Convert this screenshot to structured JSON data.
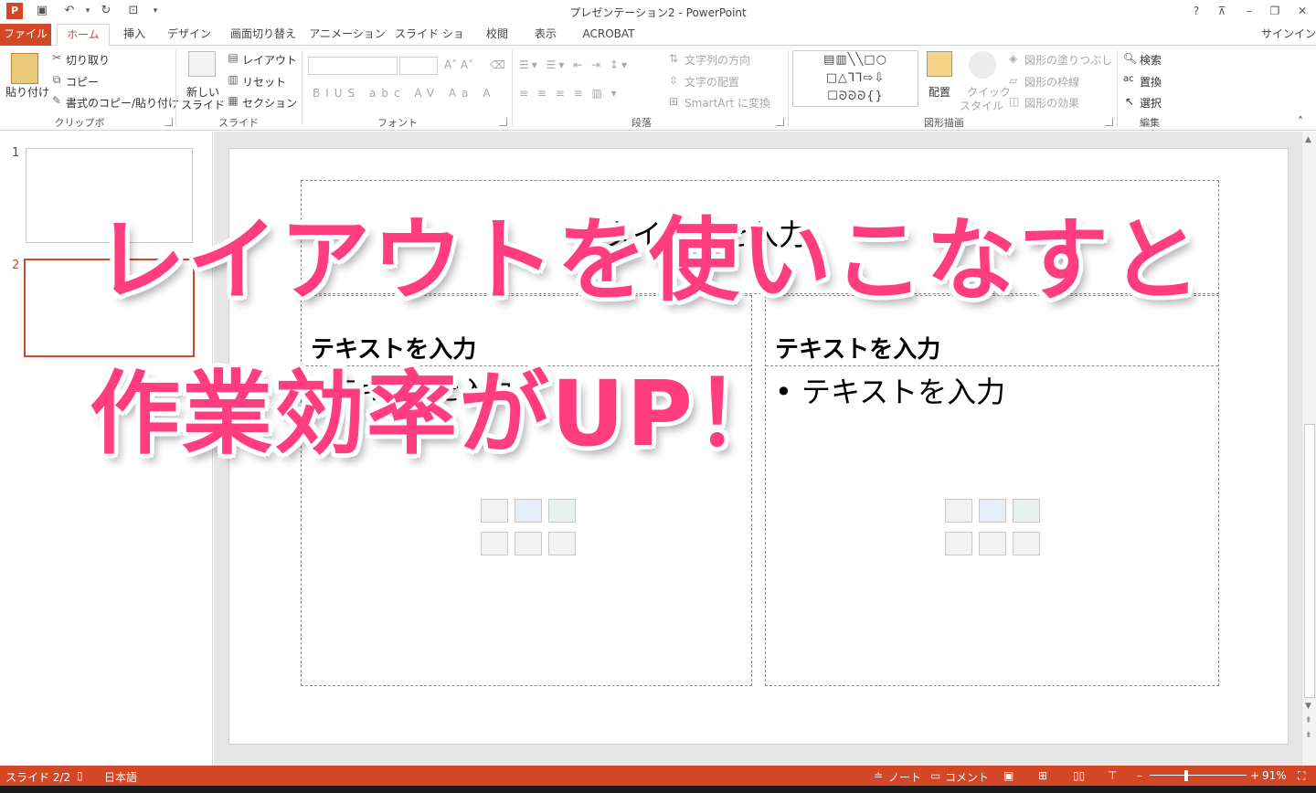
{
  "window": {
    "title": "プレゼンテーション2 - PowerPoint",
    "help": "?",
    "signin": "サインイン"
  },
  "tabs": [
    "ファイル",
    "ホーム",
    "挿入",
    "デザイン",
    "画面切り替え",
    "アニメーション",
    "スライド ショー",
    "校閲",
    "表示",
    "ACROBAT"
  ],
  "ribbon": {
    "clipboard": {
      "label": "クリップボード",
      "paste": "貼り付け",
      "cut": "切り取り",
      "copy": "コピー",
      "format_painter": "書式のコピー/貼り付け"
    },
    "slides": {
      "label": "スライド",
      "new_slide_1": "新しい",
      "new_slide_2": "スライド",
      "layout": "レイアウト",
      "reset": "リセット",
      "section": "セクション"
    },
    "font": {
      "label": "フォント"
    },
    "paragraph": {
      "label": "段落",
      "text_direction": "文字列の方向",
      "align_text": "文字の配置",
      "smartart": "SmartArt に変換"
    },
    "drawing": {
      "label": "図形描画",
      "arrange": "配置",
      "quick_styles_1": "クイック",
      "quick_styles_2": "スタイル",
      "shape_fill": "図形の塗りつぶし",
      "shape_outline": "図形の枠線",
      "shape_effects": "図形の効果"
    },
    "editing": {
      "label": "編集",
      "find": "検索",
      "replace": "置換",
      "select": "選択"
    }
  },
  "thumbnails": [
    "1",
    "2"
  ],
  "slide": {
    "title_placeholder": "タイトルを入力",
    "left_heading": "テキストを入力",
    "left_bullet": "• テキストを入力",
    "right_heading": "テキストを入力",
    "right_bullet": "• テキストを入力"
  },
  "overlay": {
    "line1": "レイアウトを使いこなすと",
    "line2": "作業効率がUP！"
  },
  "statusbar": {
    "slide_count": "スライド 2/2",
    "language": "日本語",
    "notes": "ノート",
    "comments": "コメント",
    "zoom": "91%"
  },
  "colors": {
    "accent": "#d24726",
    "headline": "#ff3d7f"
  }
}
